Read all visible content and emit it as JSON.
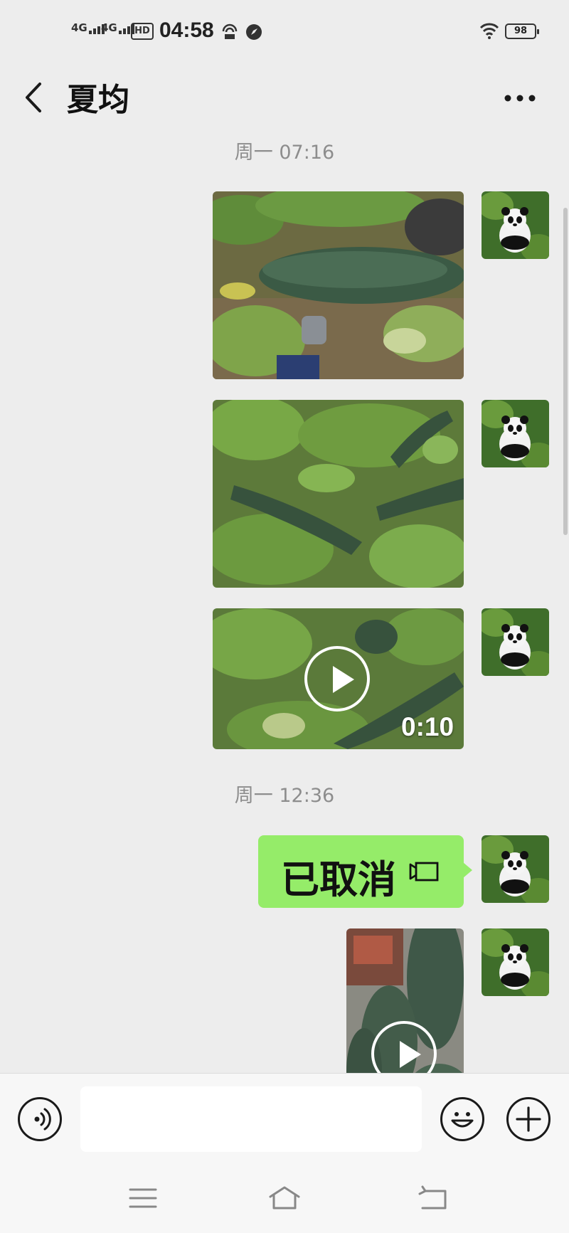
{
  "status_bar": {
    "signal1": "4G",
    "signal2": "4G",
    "hd": "HD",
    "time": "04:58",
    "battery": "98"
  },
  "header": {
    "title": "夏均",
    "back_icon": "chevron-left-icon",
    "more_icon": "ellipsis-icon"
  },
  "messages": [
    {
      "type": "timestamp",
      "text": "周一 07:16"
    },
    {
      "type": "image",
      "sender": "self",
      "content": "wax gourd lying among vines"
    },
    {
      "type": "image",
      "sender": "self",
      "content": "wax gourds among leaves"
    },
    {
      "type": "video",
      "sender": "self",
      "duration": "0:10"
    },
    {
      "type": "timestamp",
      "text": "周一 12:36"
    },
    {
      "type": "call",
      "sender": "self",
      "text": "已取消",
      "icon": "video-call-icon"
    },
    {
      "type": "video",
      "sender": "self",
      "duration": ""
    }
  ],
  "input_bar": {
    "voice_icon": "voice-icon",
    "emoji_icon": "emoji-icon",
    "plus_icon": "plus-icon",
    "placeholder": ""
  },
  "nav_bar": {
    "menu_icon": "menu-icon",
    "home_icon": "home-icon",
    "back_icon": "back-icon"
  },
  "colors": {
    "background": "#ededed",
    "bubble": "#95ec69",
    "timestamp": "#8d8d8d"
  }
}
